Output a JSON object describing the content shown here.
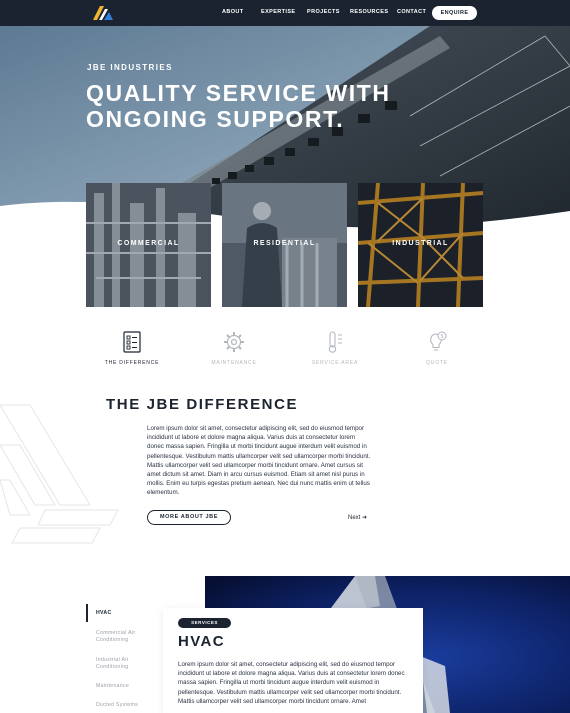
{
  "nav": {
    "items": [
      "ABOUT",
      "EXPERTISE",
      "PROJECTS",
      "RESOURCES",
      "CONTACT"
    ],
    "cta": "ENQUIRE"
  },
  "hero": {
    "brand": "JBE INDUSTRIES",
    "title": "QUALITY SERVICE WITH ONGOING SUPPORT."
  },
  "cards": [
    {
      "label": "COMMERCIAL"
    },
    {
      "label": "RESIDENTIAL"
    },
    {
      "label": "INDUSTRIAL"
    }
  ],
  "features": [
    {
      "label": "THE DIFFERENCE",
      "icon": "checklist-icon",
      "active": true
    },
    {
      "label": "MAINTENANCE",
      "icon": "gear-icon",
      "active": false
    },
    {
      "label": "SERVICE AREA",
      "icon": "thermometer-icon",
      "active": false
    },
    {
      "label": "QUOTE",
      "icon": "lightbulb-dollar-icon",
      "active": false
    }
  ],
  "difference": {
    "title": "THE JBE DIFFERENCE",
    "body": "Lorem ipsum dolor sit amet, consectetur adipiscing elit, sed do eiusmod tempor incididunt ut labore et dolore magna aliqua. Varius duis at consectetur lorem donec massa sapien. Fringilla ut morbi tincidunt augue interdum velit euismod in pellentesque. Vestibulum mattis ullamcorper velit sed ullamcorper morbi tincidunt. Mattis ullamcorper velit sed ullamcorper morbi tincidunt ornare. Amet cursus sit amet dictum sit amet. Diam in arcu cursus euismod. Etiam sit amet nisl purus in mollis. Enim eu turpis egestas pretium aenean. Nec dui nunc mattis enim ut tellus elementum.",
    "button": "MORE ABOUT JBE",
    "next": "Next"
  },
  "services": {
    "items": [
      "HVAC",
      "Commercial Air Conditioning",
      "Industrial Air Conditioning",
      "Maintenance",
      "Ducted Systems"
    ],
    "pill": "SERVICES",
    "title": "HVAC",
    "body": "Lorem ipsum dolor sit amet, consectetur adipiscing elit, sed do eiusmod tempor incididunt ut labore et dolore magna aliqua. Varius duis at consectetur lorem donec massa sapien. Fringilla ut morbi tincidunt augue interdum velit euismod in pellentesque. Vestibulum mattis ullamcorper velit sed ullamcorper morbi tincidunt. Mattis ullamcorper velit sed ullamcorper morbi tincidunt ornare. Amet"
  },
  "colors": {
    "navy": "#1b2330",
    "accent_yellow": "#f2b531",
    "accent_blue": "#2f7fd6"
  }
}
